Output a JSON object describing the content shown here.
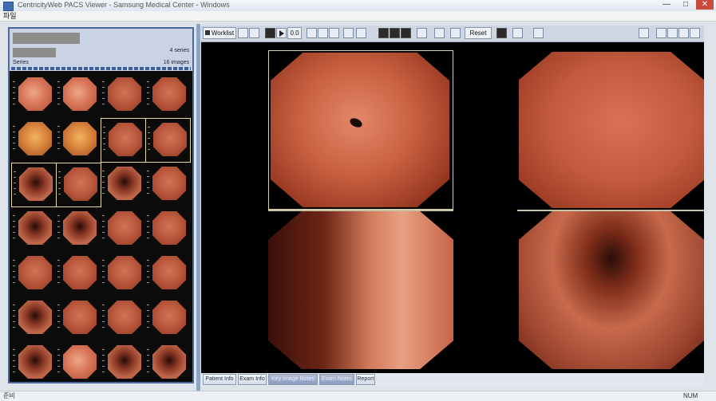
{
  "window": {
    "title": "CentricityWeb PACS Viewer - Samsung Medical Center - Windows",
    "controls": [
      "—",
      "□",
      "✕"
    ]
  },
  "menu": {
    "item": "파일"
  },
  "study_panel": {
    "series_count": "4 series",
    "series_label": "Series",
    "image_count": "16 images"
  },
  "toolbar": {
    "worklist": "Worklist",
    "frame_value": "0.0",
    "reset": "Reset"
  },
  "bottom_tabs": [
    {
      "label": "Patient Info",
      "active": false
    },
    {
      "label": "Exam Info",
      "active": false
    },
    {
      "label": "Key Image Notes",
      "active": true
    },
    {
      "label": "Exam Notes",
      "active": true
    },
    {
      "label": "Report",
      "active": false
    }
  ],
  "status": {
    "left": "준비",
    "right": "NUM"
  },
  "colors": {
    "panel_border": "#4a6a9a",
    "toolbar_bg": "#ced6e4",
    "tissue_base": "#c0553a",
    "tissue_highlight": "#ef9373",
    "tissue_shadow": "#5e1a10"
  },
  "thumbnails": [
    {
      "tone": "pale",
      "selected": false
    },
    {
      "tone": "pale",
      "selected": false
    },
    {
      "tone": "mid",
      "selected": false
    },
    {
      "tone": "mid",
      "selected": false
    },
    {
      "tone": "yellow",
      "selected": false
    },
    {
      "tone": "yellow",
      "selected": false
    },
    {
      "tone": "mid",
      "selected": true
    },
    {
      "tone": "mid",
      "selected": true
    },
    {
      "tone": "dark",
      "selected": true
    },
    {
      "tone": "mid",
      "selected": true
    },
    {
      "tone": "dark",
      "selected": false
    },
    {
      "tone": "mid",
      "selected": false
    },
    {
      "tone": "dark",
      "selected": false
    },
    {
      "tone": "dark",
      "selected": false
    },
    {
      "tone": "mid",
      "selected": false
    },
    {
      "tone": "mid",
      "selected": false
    },
    {
      "tone": "mid",
      "selected": false
    },
    {
      "tone": "mid",
      "selected": false
    },
    {
      "tone": "mid",
      "selected": false
    },
    {
      "tone": "mid",
      "selected": false
    },
    {
      "tone": "dark",
      "selected": false
    },
    {
      "tone": "mid",
      "selected": false
    },
    {
      "tone": "mid",
      "selected": false
    },
    {
      "tone": "mid",
      "selected": false
    },
    {
      "tone": "dark",
      "selected": false
    },
    {
      "tone": "pale",
      "selected": false
    },
    {
      "tone": "dark",
      "selected": false
    },
    {
      "tone": "dark",
      "selected": false
    }
  ]
}
